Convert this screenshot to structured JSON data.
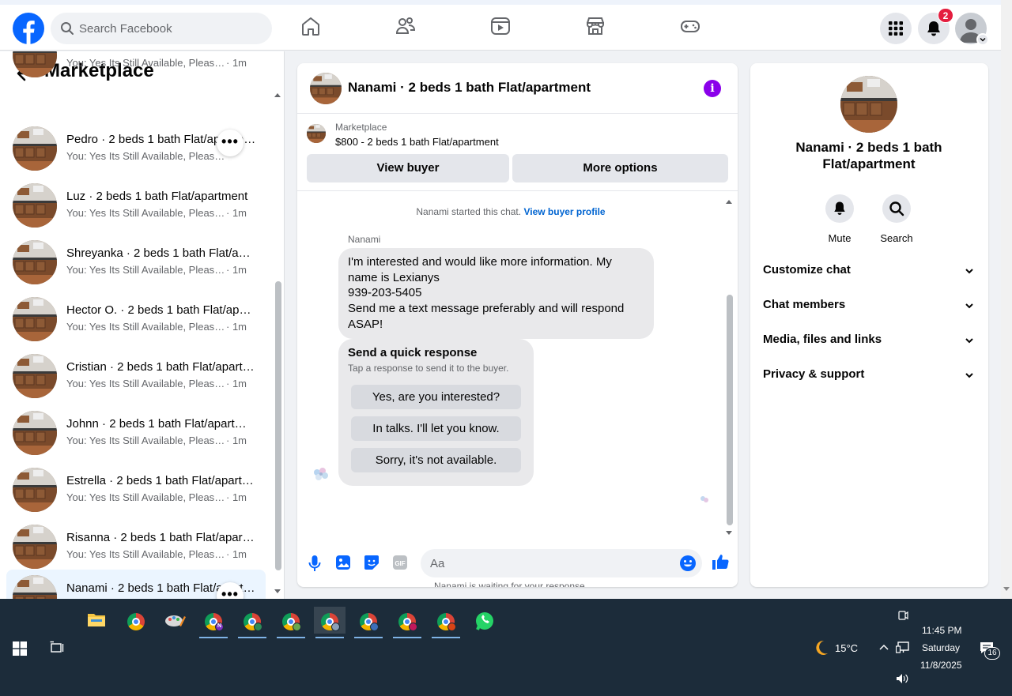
{
  "header": {
    "search_placeholder": "Search Facebook",
    "notification_count": "2",
    "nav_icons": [
      "home-icon",
      "friends-icon",
      "watch-icon",
      "marketplace-icon",
      "gaming-icon"
    ]
  },
  "left_panel": {
    "title": "Marketplace",
    "conversations": [
      {
        "title": "",
        "preview": "You: Yes Its Still Available, Please S...",
        "time": "· 1m"
      },
      {
        "title": "Pedro · 2 beds 1 bath Flat/apartment",
        "preview": "You: Yes Its Still Available, Please S...",
        "time": ""
      },
      {
        "title": "Luz · 2 beds 1 bath Flat/apartment",
        "preview": "You: Yes Its Still Available, Please S...",
        "time": "· 1m"
      },
      {
        "title": "Shreyanka · 2 beds 1 bath Flat/apartment",
        "preview": "You: Yes Its Still Available, Please S...",
        "time": "· 1m"
      },
      {
        "title": "Hector O. · 2 beds 1 bath Flat/apartment",
        "preview": "You: Yes Its Still Available, Please S...",
        "time": "· 1m"
      },
      {
        "title": "Cristian · 2 beds 1 bath Flat/apartment",
        "preview": "You: Yes Its Still Available, Please S...",
        "time": "· 1m"
      },
      {
        "title": "Johnn · 2 beds 1 bath Flat/apartment",
        "preview": "You: Yes Its Still Available, Please S...",
        "time": "· 1m"
      },
      {
        "title": "Estrella · 2 beds 1 bath Flat/apartment",
        "preview": "You: Yes Its Still Available, Please S...",
        "time": "· 1m"
      },
      {
        "title": "Risanna · 2 beds 1 bath Flat/apartment",
        "preview": "You: Yes Its Still Available, Please S...",
        "time": "· 1m"
      },
      {
        "title": "Nanami · 2 beds 1 bath Flat/apartment",
        "preview": "",
        "time": ""
      }
    ],
    "more_label": "•••"
  },
  "chat": {
    "header_name": "Nanami · 2 beds 1 bath Flat/apartment",
    "marketplace_label": "Marketplace",
    "listing": "$800 - 2 beds 1 bath Flat/apartment",
    "view_buyer_label": "View buyer",
    "more_options_label": "More options",
    "started_text": "Nanami started this chat.",
    "view_profile_link": "View buyer profile",
    "sender": "Nanami",
    "message_lines": [
      "I'm interested and would like more information. My",
      "name is Lexianys",
      "939-203-5405",
      "Send me a text message preferably and will respond",
      "ASAP!"
    ],
    "quick_title": "Send a quick response",
    "quick_subtitle": "Tap a response to send it to the buyer.",
    "quick_responses": [
      "Yes, are you interested?",
      "In talks. I'll let you know.",
      "Sorry, it's not available."
    ],
    "waiting_text": "Nanami is waiting for your response.",
    "composer_placeholder": "Aa"
  },
  "right_panel": {
    "name": "Nanami · 2 beds 1 bath Flat/apartment",
    "mute_label": "Mute",
    "search_label": "Search",
    "sections": [
      "Customize chat",
      "Chat members",
      "Media, files and links",
      "Privacy & support"
    ]
  },
  "taskbar": {
    "weather": "15°C",
    "time": "11:45 PM",
    "day": "Saturday",
    "date": "11/8/2025",
    "notifications": "16"
  },
  "colors": {
    "facebook_blue": "#0866ff",
    "link_blue": "#0064d1",
    "info_purple": "#8a00ea",
    "badge_red": "#e41e3f",
    "taskbar": "#1c2c3a"
  }
}
